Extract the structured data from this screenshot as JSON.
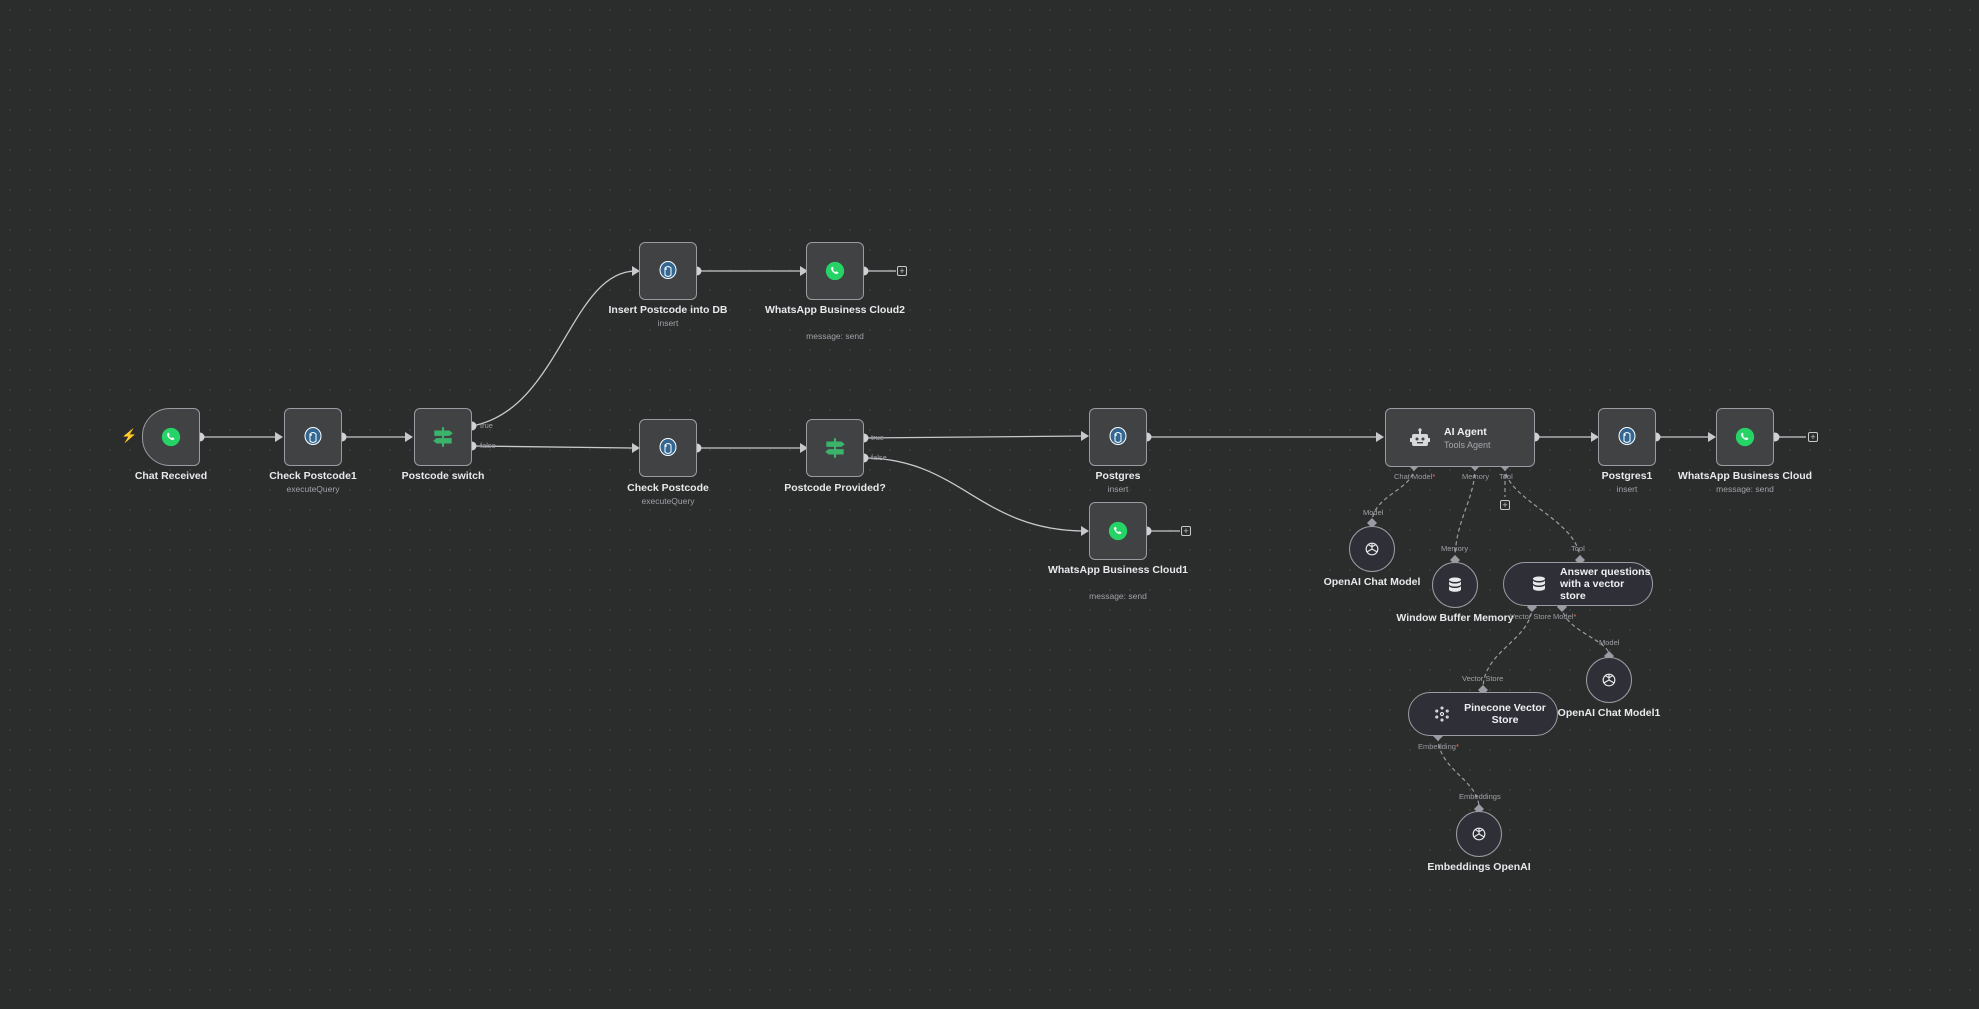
{
  "canvas": {
    "background": "#2b2c2c"
  },
  "nodes": {
    "chat_received": {
      "title": "Chat Received",
      "icon": "whatsapp-icon"
    },
    "check_postcode1": {
      "title": "Check Postcode1",
      "subtitle": "executeQuery",
      "icon": "postgres-icon"
    },
    "postcode_switch": {
      "title": "Postcode switch",
      "icon": "if-icon",
      "true_label": "true",
      "false_label": "false"
    },
    "insert_postcode": {
      "title": "Insert Postcode into DB",
      "subtitle": "insert",
      "icon": "postgres-icon"
    },
    "whatsapp_cloud2": {
      "title": "WhatsApp Business Cloud2",
      "subtitle": "message: send",
      "icon": "whatsapp-icon"
    },
    "check_postcode": {
      "title": "Check Postcode",
      "subtitle": "executeQuery",
      "icon": "postgres-icon"
    },
    "postcode_provided": {
      "title": "Postcode Provided?",
      "icon": "if-icon",
      "true_label": "true",
      "false_label": "false"
    },
    "postgres": {
      "title": "Postgres",
      "subtitle": "insert",
      "icon": "postgres-icon"
    },
    "whatsapp_cloud1": {
      "title": "WhatsApp Business Cloud1",
      "subtitle": "message: send",
      "icon": "whatsapp-icon"
    },
    "ai_agent": {
      "title": "AI Agent",
      "subtitle": "Tools Agent",
      "icon": "robot-icon",
      "ports": {
        "chat_model": "Chat Model",
        "memory": "Memory",
        "tool": "Tool"
      }
    },
    "postgres1": {
      "title": "Postgres1",
      "subtitle": "insert",
      "icon": "postgres-icon"
    },
    "whatsapp_cloud": {
      "title": "WhatsApp Business Cloud",
      "subtitle": "message: send",
      "icon": "whatsapp-icon"
    },
    "openai_chat_model": {
      "title": "OpenAI Chat Model",
      "icon": "openai-icon",
      "handle": "Model"
    },
    "window_buffer": {
      "title": "Window Buffer Memory",
      "icon": "database-icon",
      "handle": "Memory"
    },
    "answer_vector": {
      "title": "Answer questions with a vector store",
      "icon": "database-icon",
      "handle": "Tool",
      "ports": {
        "vector_store": "Vector Store",
        "model": "Model"
      }
    },
    "openai_chat_model1": {
      "title": "OpenAI Chat Model1",
      "icon": "openai-icon",
      "handle": "Model"
    },
    "pinecone": {
      "title": "Pinecone Vector Store",
      "icon": "pinecone-icon",
      "handle": "Vector Store",
      "ports": {
        "embedding": "Embedding"
      }
    },
    "embeddings_openai": {
      "title": "Embeddings OpenAI",
      "icon": "openai-icon",
      "handle": "Embeddings"
    }
  },
  "colors": {
    "node_bg": "#414244",
    "node_border": "#9a9ca3",
    "edge": "#c8c9cc",
    "whatsapp": "#25d366",
    "if_green": "#3bb36b",
    "postgres_blue": "#336791",
    "required": "#ff6d5a"
  }
}
